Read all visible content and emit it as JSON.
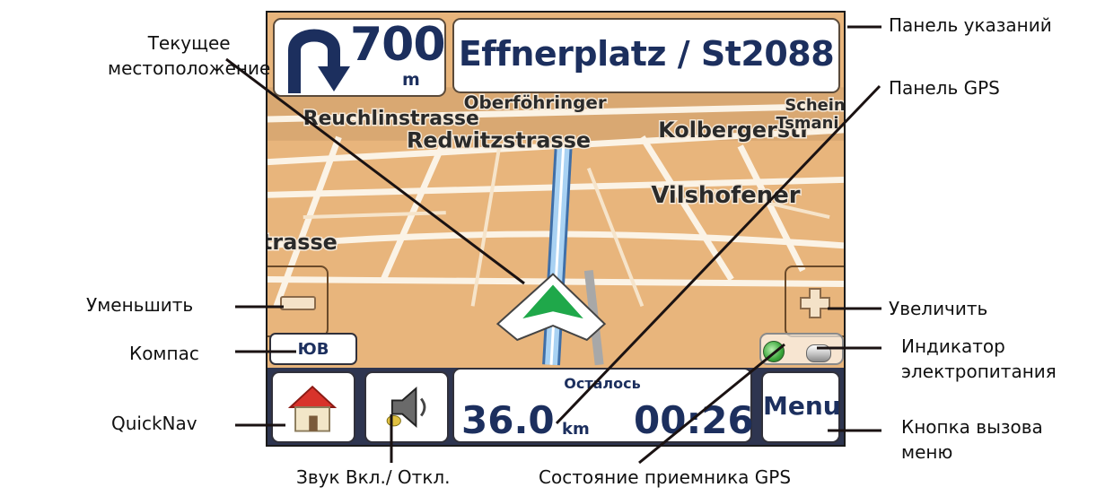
{
  "navigation": {
    "turn_distance": "700",
    "turn_unit": "m",
    "street_name": "Effnerplatz / St2088",
    "compass_heading": "ЮВ",
    "remaining_label": "Осталось",
    "remaining_distance": "36.0",
    "remaining_distance_unit": "km",
    "remaining_time": "00:26",
    "menu_label": "Menu"
  },
  "map": {
    "street_labels": [
      "Reuchlinstrasse",
      "Oberföhringer",
      "Redwitzstrasse",
      "Kolbergerstr",
      "Vilshofener",
      "trasse",
      "Scheine",
      "Tsmani"
    ]
  },
  "annotations": {
    "current_position": "Текущее\nместоположение",
    "instruction_panel": "Панель указаний",
    "gps_panel": "Панель GPS",
    "zoom_out": "Уменьшить",
    "zoom_in": "Увеличить",
    "compass": "Компас",
    "power_indicator": "Индикатор\nэлектропитания",
    "quicknav": "QuickNav",
    "menu_button": "Кнопка вызова\nменю",
    "sound_toggle": "Звук Вкл./ Откл.",
    "gps_receiver_state": "Состояние приемника GPS"
  },
  "icons": {
    "turn": "u-turn-arrow-icon",
    "home": "home-icon",
    "sound": "speaker-icon",
    "gps": "gps-status-icon",
    "power": "battery-icon",
    "zoom_in": "plus-icon",
    "zoom_out": "minus-icon"
  },
  "colors": {
    "map_background": "#e8b57c",
    "route": "#9cc7ef",
    "position_arrow": "#1fa84a",
    "ui_text": "#1c2f5e"
  }
}
